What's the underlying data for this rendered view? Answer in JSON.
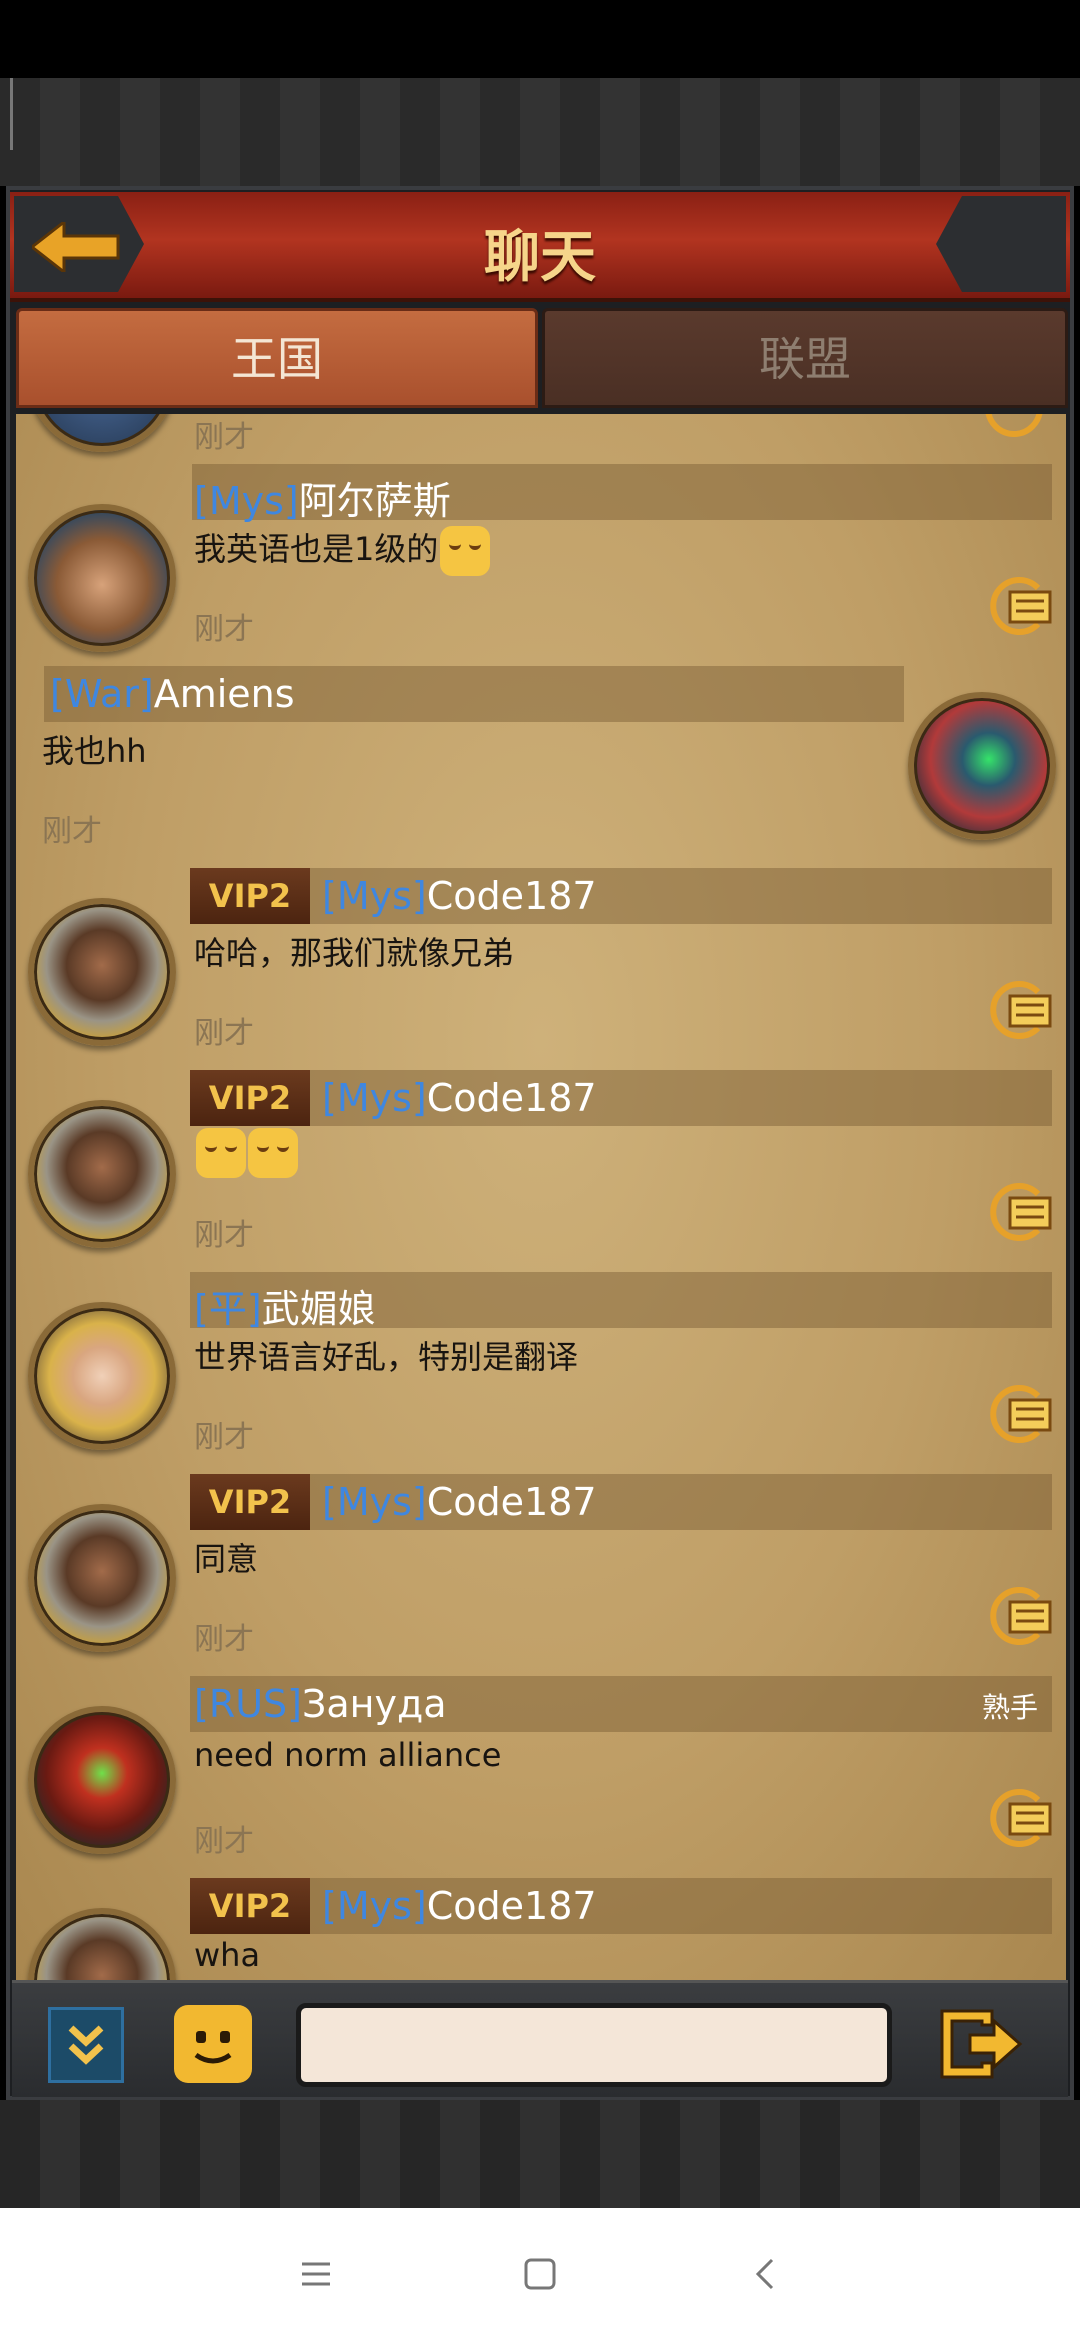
{
  "header": {
    "title": "聊天"
  },
  "tabs": [
    {
      "label": "王国"
    },
    {
      "label": "联盟"
    }
  ],
  "partial_top": {
    "time": "刚才"
  },
  "messages": [
    {
      "tag": "[Mys]",
      "name": "阿尔萨斯",
      "text": "我英语也是1级的",
      "time": "刚才"
    },
    {
      "tag": "[War]",
      "name": "Amiens",
      "text": "我也hh",
      "time": "刚才"
    },
    {
      "vip": "VIP2",
      "tag": "[Mys]",
      "name": "Code187",
      "text": "哈哈，那我们就像兄弟",
      "time": "刚才"
    },
    {
      "vip": "VIP2",
      "tag": "[Mys]",
      "name": "Code187",
      "text": "",
      "time": "刚才"
    },
    {
      "tag": "[平]",
      "name": "武媚娘",
      "text": "世界语言好乱，特别是翻译",
      "time": "刚才"
    },
    {
      "vip": "VIP2",
      "tag": "[Mys]",
      "name": "Code187",
      "text": "同意",
      "time": "刚才"
    },
    {
      "tag": "[RUS]",
      "name": "Зануда",
      "text": "need norm alliance",
      "time": "刚才",
      "rank": "熟手"
    },
    {
      "vip": "VIP2",
      "tag": "[Mys]",
      "name": "Code187",
      "text": "wha"
    }
  ],
  "icons": {
    "back": "back-arrow-icon",
    "reply": "reply-icon",
    "expand": "chevron-down-double-icon",
    "emoji": "emoji-icon",
    "send": "send-icon"
  },
  "colors": {
    "tag": "#3f87e0",
    "title": "#f6d58a",
    "vip": "#f2c24c"
  }
}
